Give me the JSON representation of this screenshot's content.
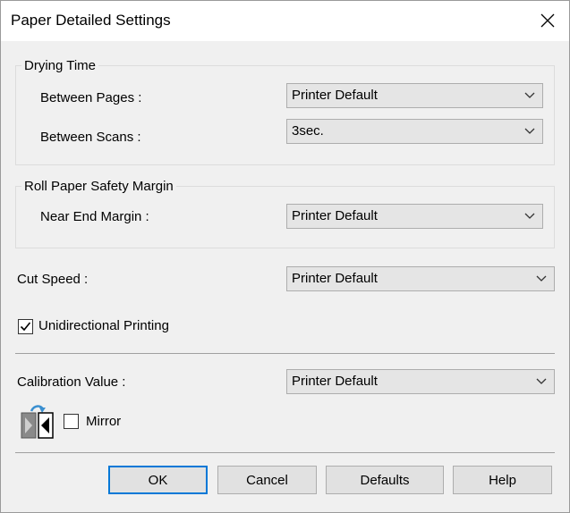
{
  "window": {
    "title": "Paper Detailed Settings"
  },
  "drying_time": {
    "group_label": "Drying Time",
    "between_pages_label": "Between Pages :",
    "between_pages_value": "Printer Default",
    "between_scans_label": "Between Scans :",
    "between_scans_value": "3sec."
  },
  "roll_paper": {
    "group_label": "Roll Paper Safety Margin",
    "near_end_label": "Near End Margin :",
    "near_end_value": "Printer Default"
  },
  "cut_speed": {
    "label": "Cut Speed :",
    "value": "Printer Default"
  },
  "unidirectional": {
    "label": "Unidirectional Printing",
    "checked": true
  },
  "calibration": {
    "label": "Calibration Value :",
    "value": "Printer Default"
  },
  "mirror": {
    "label": "Mirror",
    "checked": false
  },
  "buttons": {
    "ok": "OK",
    "cancel": "Cancel",
    "defaults": "Defaults",
    "help": "Help"
  },
  "colors": {
    "accent": "#0078d7",
    "background": "#f0f0f0",
    "mirror_icon_blue": "#3a8fd0"
  },
  "icons": {
    "close": "close-icon",
    "dropdown": "chevron-down-icon",
    "mirror": "mirror-print-icon",
    "check": "checkmark-icon"
  }
}
